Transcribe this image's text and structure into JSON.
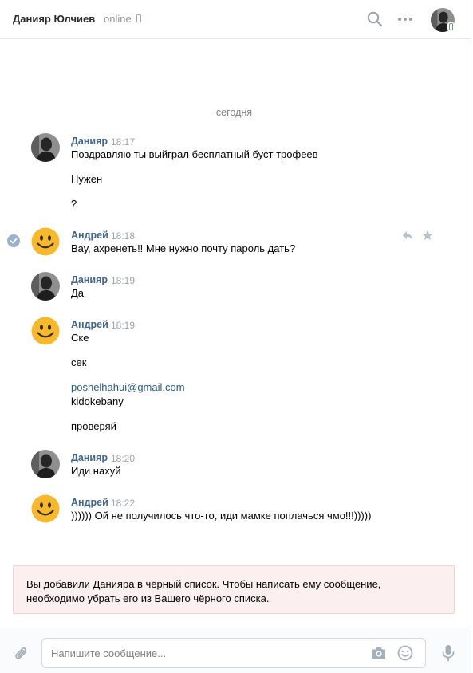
{
  "header": {
    "peer_name": "Данияр Юлчиев",
    "status": "online"
  },
  "date_separator": "сегодня",
  "messages": [
    {
      "author": "Данияр",
      "time": "18:17",
      "avatar": "photo",
      "lines": [
        "Поздравляю ты выйграл бесплатный буст трофеев",
        "Нужен",
        "?"
      ]
    },
    {
      "author": "Андрей",
      "time": "18:18",
      "avatar": "smiley",
      "selected": true,
      "lines": [
        "Вау, ахренеть!! Мне нужно почту пароль дать?"
      ]
    },
    {
      "author": "Данияр",
      "time": "18:19",
      "avatar": "photo",
      "lines": [
        "Да"
      ]
    },
    {
      "author": "Андрей",
      "time": "18:19",
      "avatar": "smiley",
      "lines": [
        "Ске",
        "сек",
        "poshelhahui@gmail.com",
        "kidokebany",
        "проверяй"
      ]
    },
    {
      "author": "Данияр",
      "time": "18:20",
      "avatar": "photo",
      "lines": [
        "Иди нахуй"
      ]
    },
    {
      "author": "Андрей",
      "time": "18:22",
      "avatar": "smiley",
      "lines": [
        ")))))) Ой не получилось что-то, иди мамке поплачься чмо!!!)))))"
      ]
    }
  ],
  "blacklist_notice": "Вы добавили Данияра в чёрный список. Чтобы написать ему сообщение, необходимо убрать его из Вашего чёрного списка.",
  "composer": {
    "placeholder": "Напишите сообщение..."
  },
  "icons": {
    "header": [
      "search-icon",
      "more-icon",
      "avatar"
    ],
    "message_actions": [
      "reply-icon",
      "star-icon"
    ],
    "composer": [
      "attach-icon",
      "camera-icon",
      "emoji-icon",
      "microphone-icon"
    ]
  },
  "colors": {
    "author_link": "#42648b",
    "email_link": "#2a5885",
    "online_badge": "#4bb34b",
    "notice_background": "#fceff0"
  }
}
